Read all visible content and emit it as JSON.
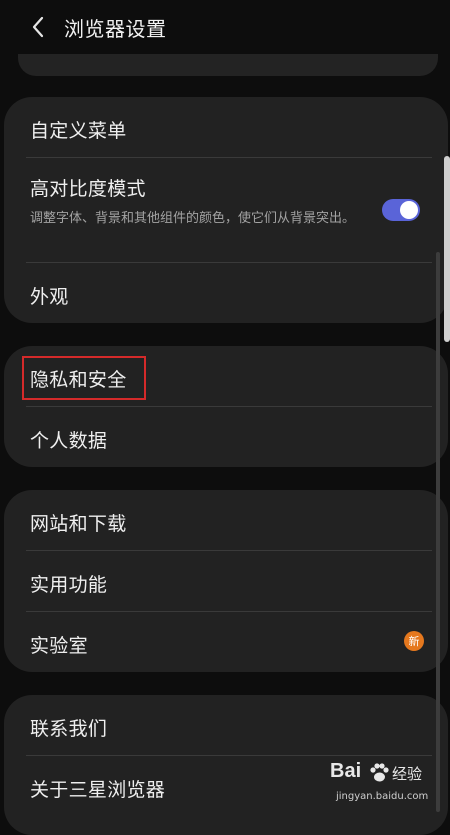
{
  "header": {
    "title": "浏览器设置"
  },
  "cards": {
    "display": {
      "custom_menu": "自定义菜单",
      "high_contrast": {
        "label": "高对比度模式",
        "description": "调整字体、背景和其他组件的颜色，使它们从背景突出。",
        "enabled": true
      },
      "appearance": "外观"
    },
    "privacy": {
      "privacy_security": "隐私和安全",
      "personal_data": "个人数据"
    },
    "sites": {
      "sites_downloads": "网站和下载",
      "useful_features": "实用功能",
      "labs": "实验室",
      "labs_badge": "新"
    },
    "about": {
      "contact_us": "联系我们",
      "about_browser": "关于三星浏览器"
    }
  },
  "watermark": {
    "brand": "Bai",
    "brand2": "经验",
    "url": "jingyan.baidu.com"
  },
  "colors": {
    "accent": "#5a64d8",
    "badge": "#e5781e",
    "highlight": "#d42a2a"
  }
}
